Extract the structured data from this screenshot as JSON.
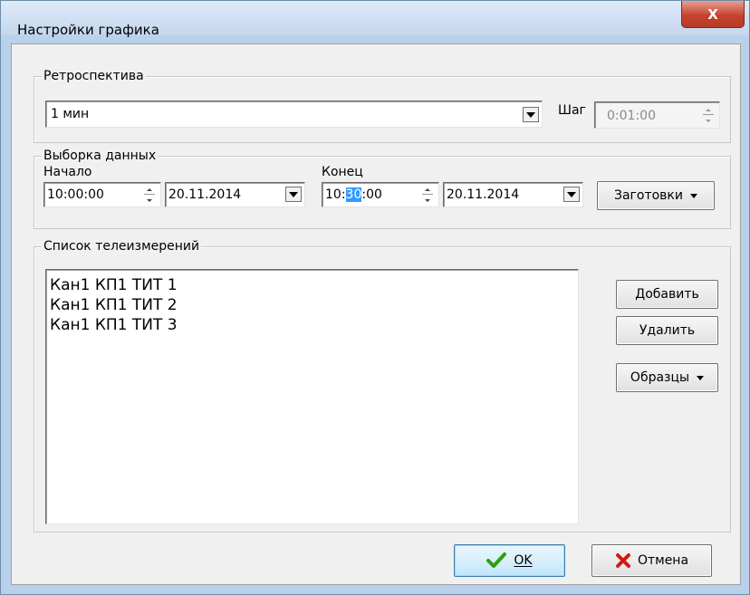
{
  "window": {
    "title": "Настройки графика",
    "close_glyph": "X"
  },
  "retro": {
    "legend": "Ретроспектива",
    "selected": "1 мин",
    "step_label": "Шаг",
    "step_value": "0:01:00"
  },
  "sample": {
    "legend": "Выборка данных",
    "start_label": "Начало",
    "start_time": "10:00:00",
    "start_date": "20.11.2014",
    "end_label": "Конец",
    "end_time_prefix": "10:",
    "end_time_selected": "30",
    "end_time_suffix": ":00",
    "end_date": "20.11.2014",
    "presets_label": "Заготовки"
  },
  "telemetry": {
    "legend": "Список телеизмерений",
    "items": [
      "Кан1 КП1 ТИТ 1",
      "Кан1 КП1 ТИТ 2",
      "Кан1 КП1 ТИТ 3"
    ],
    "add_label": "Добавить",
    "delete_label": "Удалить",
    "samples_label": "Образцы"
  },
  "footer": {
    "ok_label": "OK",
    "cancel_label": "Отмена"
  },
  "colors": {
    "selection": "#3399ff",
    "ok_check": "#2f9e12",
    "cancel_x": "#d01b12"
  }
}
